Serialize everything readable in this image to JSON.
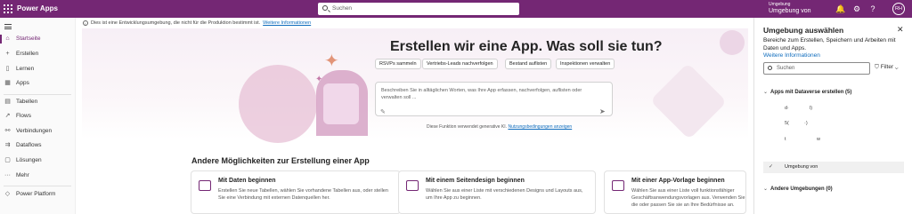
{
  "topbar": {
    "app_name": "Power Apps",
    "search_placeholder": "Suchen",
    "env_label": "Umgebung",
    "env_value": "Umgebung von"
  },
  "sidebar": {
    "items": [
      {
        "label": "Startseite",
        "icon": "home-icon"
      },
      {
        "label": "Erstellen",
        "icon": "plus-icon"
      },
      {
        "label": "Lernen",
        "icon": "book-icon"
      },
      {
        "label": "Apps",
        "icon": "apps-icon"
      },
      {
        "label": "Tabellen",
        "icon": "table-icon"
      },
      {
        "label": "Flows",
        "icon": "flow-icon"
      },
      {
        "label": "Verbindungen",
        "icon": "connection-icon"
      },
      {
        "label": "Dataflows",
        "icon": "dataflow-icon"
      },
      {
        "label": "Lösungen",
        "icon": "solution-icon"
      },
      {
        "label": "Mehr",
        "icon": "more-icon"
      },
      {
        "label": "Power Platform",
        "icon": "power-platform-icon"
      }
    ]
  },
  "notice": {
    "text": "Dies ist eine Entwicklungsumgebung, die nicht für die Produktion bestimmt ist.",
    "link": "Weitere Informationen"
  },
  "hero": {
    "title": "Erstellen wir eine App. Was soll sie tun?",
    "chips": [
      "RSVPs sammeln",
      "Vertriebs-Leads nachverfolgen",
      "Bestand auflisten",
      "Inspektionen verwalten"
    ],
    "prompt_placeholder": "Beschreiben Sie in alltäglichen Worten, was Ihre App erfassen, nachverfolgen, auflisten oder verwalten soll ...",
    "disclaimer_text": "Diese Funktion verwendet generative KI.",
    "disclaimer_link": "Nutzungsbedingungen anzeigen"
  },
  "other": {
    "title": "Andere Möglichkeiten zur Erstellung einer App",
    "cards": [
      {
        "title": "Mit Daten beginnen",
        "desc": "Erstellen Sie neue Tabellen, wählen Sie vorhandene Tabellen aus, oder stellen Sie eine Verbindung mit externen Datenquellen her."
      },
      {
        "title": "Mit einem Seitendesign beginnen",
        "desc": "Wählen Sie aus einer Liste mit verschiedenen Designs und Layouts aus, um Ihre App zu beginnen."
      },
      {
        "title": "Mit einer App-Vorlage beginnen",
        "desc": "Wählen Sie aus einer Liste voll funktionsfähiger Geschäftsanwendungsvorlagen aus. Verwenden Sie die oder passen Sie sie an Ihre Bedürfnisse an."
      }
    ]
  },
  "panel": {
    "title": "Umgebung auswählen",
    "desc": "Bereiche zum Erstellen, Speichern und Arbeiten mit Daten und Apps.",
    "link": "Weitere Informationen",
    "search_placeholder": "Suchen",
    "filter_label": "Filter",
    "group1": "Apps mit Dataverse erstellen (5)",
    "rows": [
      "d·",
      "l)",
      "5(",
      "·)",
      "t",
      "w"
    ],
    "selected": "Umgebung von",
    "group2": "Andere Umgebungen (0)"
  },
  "colors": {
    "brand": "#742774",
    "link": "#0f6cbd"
  }
}
